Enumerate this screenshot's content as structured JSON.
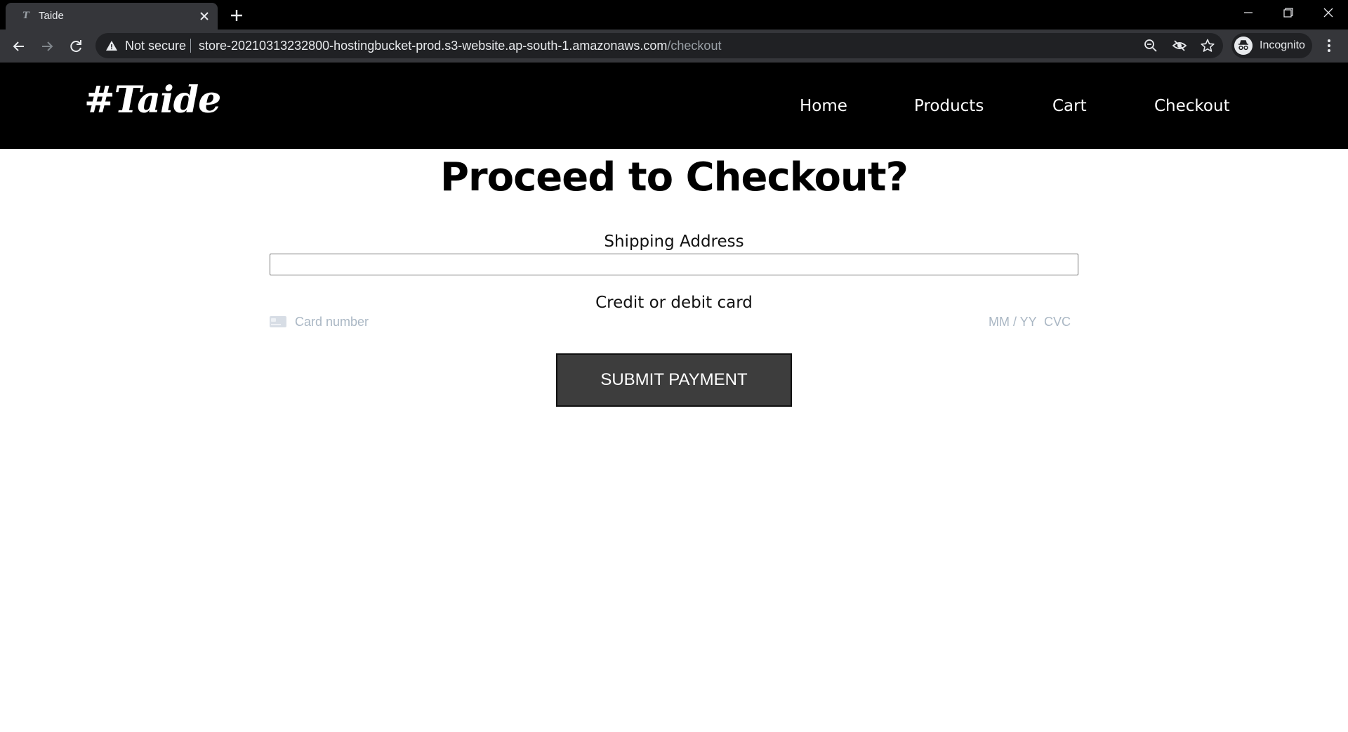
{
  "browser": {
    "tab": {
      "title": "Taide",
      "favicon": "T"
    },
    "address_bar": {
      "security": "Not secure",
      "url_host": "store-20210313232800-hostingbucket-prod.s3-website.ap-south-1.amazonaws.com",
      "url_path": "/checkout"
    },
    "profile": {
      "label": "Incognito"
    },
    "icons": [
      "back-arrow-icon",
      "forward-arrow-icon",
      "reload-icon",
      "warning-icon",
      "zoom-icon",
      "eye-off-icon",
      "star-icon",
      "incognito-icon",
      "kebab-menu-icon",
      "close-icon",
      "plus-icon",
      "minimize-icon",
      "restore-icon"
    ]
  },
  "site": {
    "logo": "#Taide",
    "nav": {
      "home": "Home",
      "products": "Products",
      "cart": "Cart",
      "checkout": "Checkout"
    }
  },
  "checkout": {
    "title": "Proceed to Checkout?",
    "shipping_label": "Shipping Address",
    "shipping_value": "",
    "card_label": "Credit or debit card",
    "card_number_placeholder": "Card number",
    "expiry_placeholder": "MM / YY",
    "cvc_placeholder": "CVC",
    "submit_label": "SUBMIT PAYMENT"
  },
  "colors": {
    "header_bg": "#000000",
    "button_bg": "#3d3d3d",
    "placeholder": "#aab7c4",
    "chrome_toolbar": "#35363a"
  }
}
